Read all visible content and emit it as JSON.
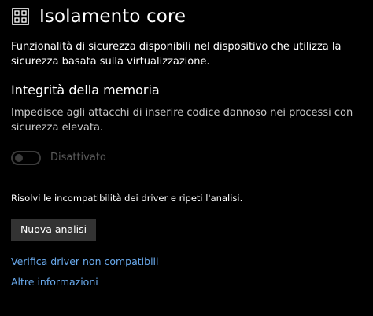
{
  "header": {
    "icon": "core-isolation-icon",
    "title": "Isolamento core"
  },
  "description": "Funzionalità di sicurezza disponibili nel dispositivo che utilizza la sicurezza basata sulla virtualizzazione.",
  "memory_integrity": {
    "title": "Integrità della memoria",
    "description": "Impedisce agli attacchi di inserire codice dannoso nei processi con sicurezza elevata.",
    "toggle": {
      "state": "off",
      "label": "Disattivato"
    }
  },
  "fix_text": "Risolvi le incompatibilità dei driver e ripeti l'analisi.",
  "button_label": "Nuova analisi",
  "links": {
    "check_drivers": "Verifica driver non compatibili",
    "more_info": "Altre informazioni"
  },
  "colors": {
    "background": "#000000",
    "text": "#ffffff",
    "secondary_text": "#c8c8c8",
    "disabled": "#5a5a5a",
    "link": "#69a9ec",
    "button": "#333333"
  }
}
